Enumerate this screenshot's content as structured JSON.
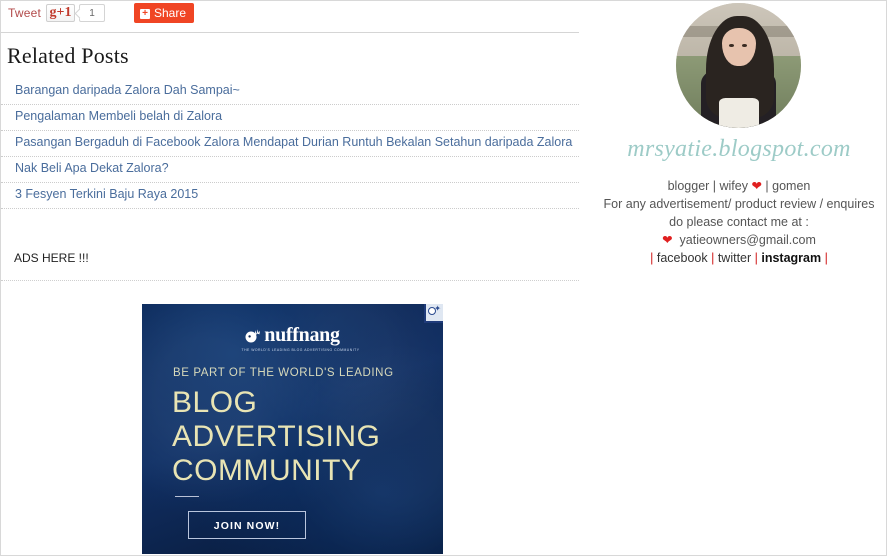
{
  "share_bar": {
    "tweet_label": "Tweet",
    "gplus_label": "g+1",
    "gplus_count": "1",
    "share_label": "Share",
    "share_plus": "+",
    "share_color": "#f04524",
    "tweet_color": "#b24a4a"
  },
  "related": {
    "heading": "Related Posts",
    "items": [
      {
        "title": "Barangan daripada Zalora Dah Sampai~"
      },
      {
        "title": "Pengalaman Membeli belah di Zalora"
      },
      {
        "title": "Pasangan Bergaduh di Facebook Zalora Mendapat Durian Runtuh Bekalan Setahun daripada Zalora"
      },
      {
        "title": "Nak Beli Apa Dekat Zalora?"
      },
      {
        "title": "3 Fesyen Terkini Baju Raya 2015"
      }
    ],
    "link_color": "#4a6d9c"
  },
  "ads_placeholder": {
    "text": "ADS HERE !!!"
  },
  "ad_banner": {
    "adchoices_icon": "adchoices-icon",
    "logo_text": "nuffnang",
    "logo_tagline": "The World's Leading Blog Advertising Community",
    "headline": "BE PART OF THE WORLD'S LEADING",
    "big_line_1": "BLOG",
    "big_line_2": "ADVERTISING",
    "big_line_3": "COMMUNITY",
    "cta_label": "JOIN NOW!",
    "bg_color": "#0a2350",
    "accent_color": "#e8e4b4"
  },
  "sidebar": {
    "avatar_alt": "profile-photo",
    "watermark": "mrsyatie.blogspot.com",
    "watermark_color": "#9dcbc7",
    "tagline_pre": "blogger | wifey ",
    "tagline_heart": "❤",
    "tagline_post": " | gomen",
    "contact_line_1": "For any advertisement/ product review / enquires",
    "contact_line_2": "do please contact me at :",
    "email_heart": "❤",
    "email": "yatieowners@gmail.com",
    "links": [
      {
        "label": "facebook",
        "bold": false
      },
      {
        "label": "twitter",
        "bold": false
      },
      {
        "label": "instagram",
        "bold": true
      }
    ],
    "pipe": "|"
  }
}
